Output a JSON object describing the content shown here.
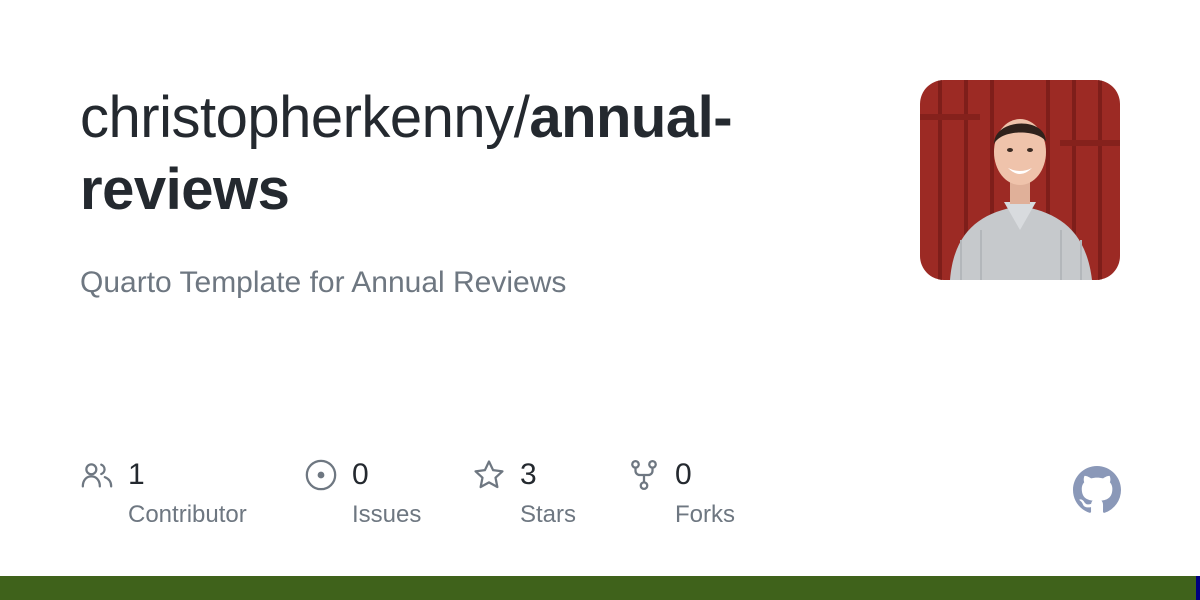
{
  "repo": {
    "owner": "christopherkenny",
    "separator": "/",
    "name": "annual-reviews",
    "description": "Quarto Template for Annual Reviews"
  },
  "avatar": {
    "icon": "user-avatar-photo"
  },
  "stats": {
    "contributors": {
      "value": "1",
      "label": "Contributor",
      "icon": "people-icon"
    },
    "issues": {
      "value": "0",
      "label": "Issues",
      "icon": "issue-opened-icon"
    },
    "stars": {
      "value": "3",
      "label": "Stars",
      "icon": "star-icon"
    },
    "forks": {
      "value": "0",
      "label": "Forks",
      "icon": "repo-forked-icon"
    }
  },
  "brand": {
    "logo_icon": "github-mark-icon",
    "language_bar_colors": [
      "#3f621b",
      "#00007f"
    ]
  },
  "colors": {
    "title": "#24292f",
    "muted": "#6e7781",
    "icon": "#6e7781",
    "logo": "#8a98b8"
  }
}
